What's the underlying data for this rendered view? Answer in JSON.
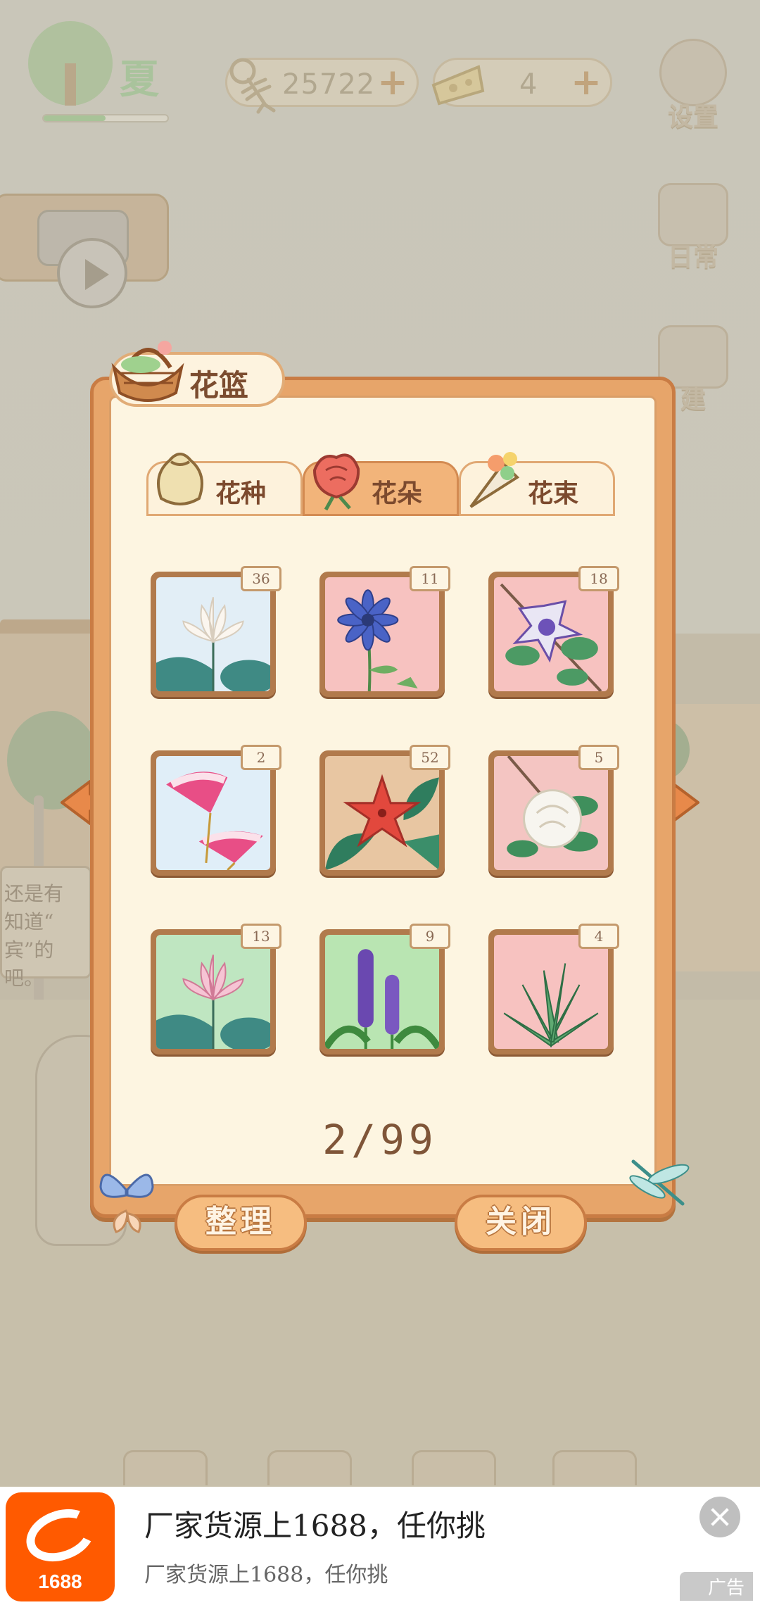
{
  "hud": {
    "season": "夏",
    "season_progress": 0.5,
    "currencies": [
      {
        "name": "fishbone",
        "icon": "fishbone-icon",
        "value": "25722"
      },
      {
        "name": "cheese",
        "icon": "cheese-icon",
        "value": "4"
      }
    ],
    "side_buttons": [
      {
        "icon": "gear-icon",
        "label": "设置"
      },
      {
        "icon": "scroll-icon",
        "label": "日常"
      },
      {
        "icon": "hammer-icon",
        "label": "建"
      }
    ]
  },
  "background": {
    "sign_text": "还是有\n知道“\n宾”的\n吧。"
  },
  "dialog": {
    "title": "花篮",
    "tabs": [
      {
        "label": "花种",
        "icon": "seed-bag-icon",
        "active": false
      },
      {
        "label": "花朵",
        "icon": "rose-icon",
        "active": true
      },
      {
        "label": "花束",
        "icon": "bouquet-icon",
        "active": false
      }
    ],
    "items": [
      {
        "flower": "white-lotus",
        "count": "36",
        "bg": "#e2eef6"
      },
      {
        "flower": "blue-daisy",
        "count": "11",
        "bg": "#f7c2c0"
      },
      {
        "flower": "purple-orchid",
        "count": "18",
        "bg": "#f7c2c0"
      },
      {
        "flower": "pink-silk-tree",
        "count": "2",
        "bg": "#e0eef8"
      },
      {
        "flower": "red-star-flower",
        "count": "52",
        "bg": "#e8c6a2"
      },
      {
        "flower": "white-gardenia",
        "count": "5",
        "bg": "#f4c5c2"
      },
      {
        "flower": "pink-lotus",
        "count": "13",
        "bg": "#bfe6c1"
      },
      {
        "flower": "purple-spike",
        "count": "9",
        "bg": "#b9e5b2"
      },
      {
        "flower": "aloe",
        "count": "4",
        "bg": "#f7c2c0"
      }
    ],
    "page_counter": "2/99",
    "buttons": {
      "sort": "整理",
      "close": "关闭"
    }
  },
  "ad": {
    "brand": "1688",
    "headline": "厂家货源上1688，任你挑",
    "sub": "厂家货源上1688，任你挑",
    "label": "广告"
  },
  "colors": {
    "frame": "#e7a56a",
    "frame_border": "#c97c44",
    "panel": "#fdf5e1",
    "accent_orange": "#ff5a00"
  }
}
